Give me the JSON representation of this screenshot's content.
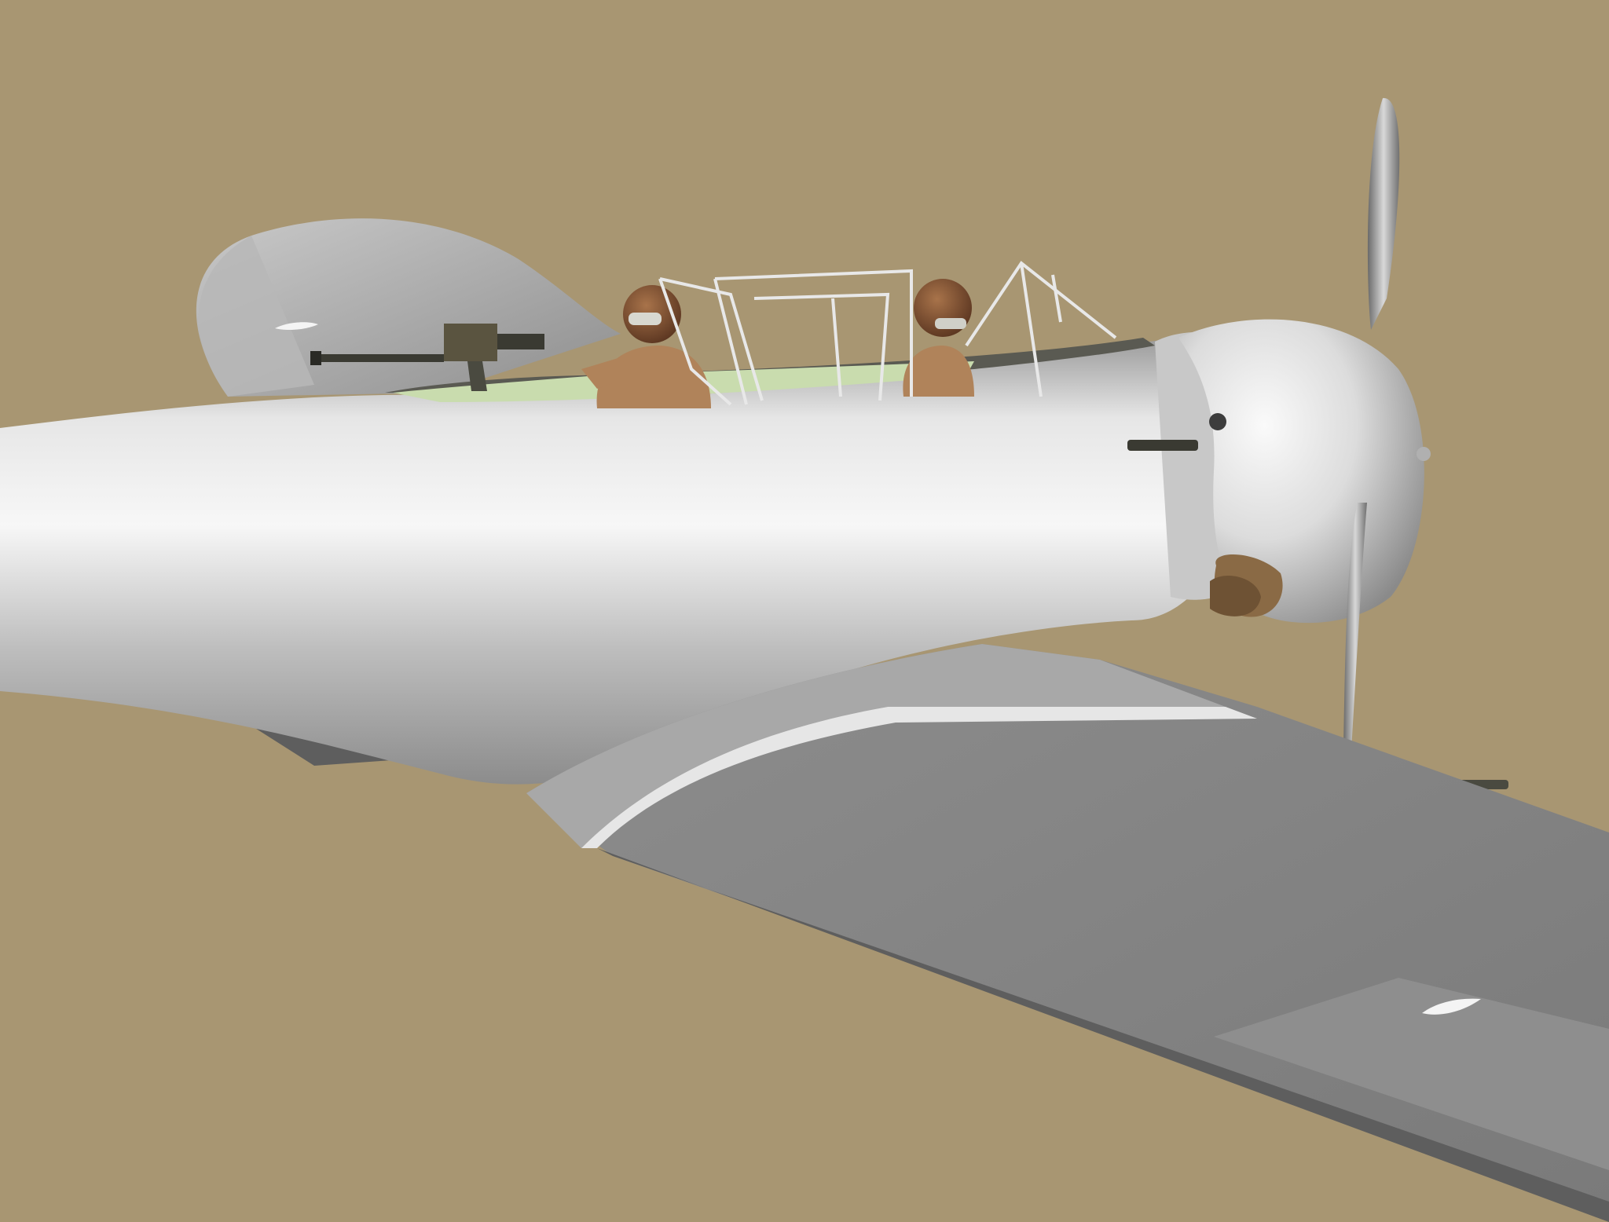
{
  "scene": {
    "subject": "",
    "colors": {
      "background": "#a89672",
      "metal_light": "#f2f2f2",
      "metal_mid": "#c4c4c4",
      "metal_dark": "#7c7c7c",
      "wing_top": "#8a8a8a",
      "wing_shadow": "#6e6e6e",
      "cockpit_interior": "#c9dcae",
      "leather": "#7a4b2e",
      "jacket": "#b0835a",
      "gun": "#3a3a32",
      "frame": "#e8e8e8"
    },
    "parts": [
      "fuselage",
      "tail-fin",
      "rudder",
      "wing",
      "aileron",
      "engine-cowling",
      "propeller",
      "spinner",
      "canopy-frame",
      "pilot",
      "gunner",
      "machine-gun",
      "wing-gun",
      "cowl-gun",
      "exhaust"
    ]
  }
}
